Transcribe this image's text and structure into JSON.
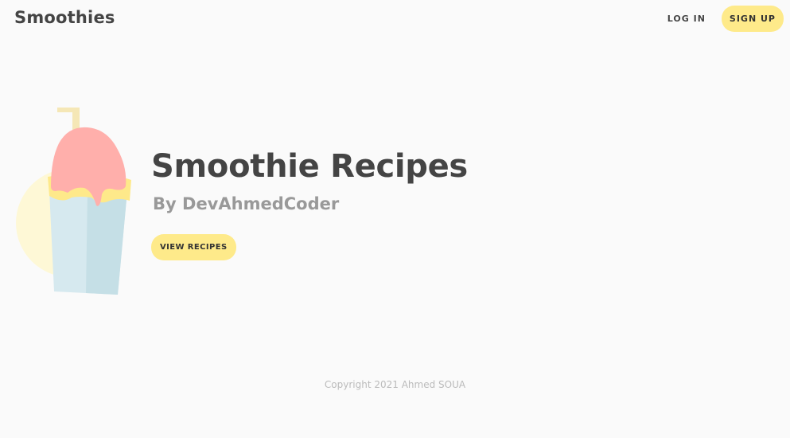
{
  "header": {
    "brand": "Smoothies",
    "login_label": "LOG IN",
    "signup_label": "SIGN UP"
  },
  "hero": {
    "title": "Smoothie Recipes",
    "subtitle": "By DevAhmedCoder",
    "button_label": "VIEW RECIPES",
    "illustration": "smoothie-cup-icon"
  },
  "footer": {
    "copyright": "Copyright 2021 Ahmed SOUA"
  },
  "colors": {
    "accent": "#feea8a",
    "background": "#fafafa",
    "text": "#444444",
    "muted": "#999999",
    "cream": "#f5d7a8",
    "cup": "#d6e9ef",
    "cup_shade": "#c5dfe6",
    "smoothie": "#ffafab",
    "circle": "#fef8d6"
  }
}
